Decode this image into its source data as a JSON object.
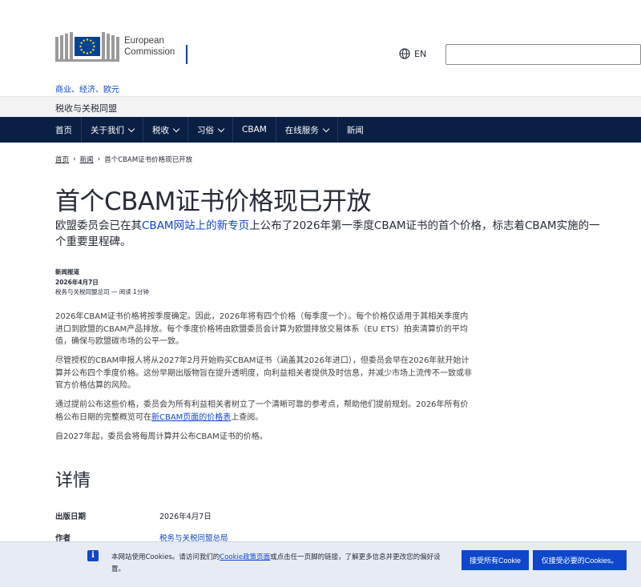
{
  "header": {
    "logo_line1": "European",
    "logo_line2": "Commission",
    "lang_code": "EN",
    "search_placeholder": "",
    "top_breadcrumb": "商业、经济、欧元"
  },
  "site": {
    "name": "税收与关税同盟"
  },
  "nav": {
    "items": [
      {
        "label": "首页",
        "dropdown": false
      },
      {
        "label": "关于我们",
        "dropdown": true
      },
      {
        "label": "税收",
        "dropdown": true
      },
      {
        "label": "习俗",
        "dropdown": true
      },
      {
        "label": "CBAM",
        "dropdown": false
      },
      {
        "label": "在线服务",
        "dropdown": true
      },
      {
        "label": "新闻",
        "dropdown": false
      }
    ]
  },
  "breadcrumbs": {
    "home": "首页",
    "news": "新闻",
    "current": "首个CBAM证书价格现已开放"
  },
  "article": {
    "title": "首个CBAM证书价格现已开放",
    "lead_before": "欧盟委员会已在其",
    "lead_link": "CBAM网站上的新专页",
    "lead_after": "上公布了2026年第一季度CBAM证书的首个价格，标志着CBAM实施的一个重要里程碑。",
    "type": "新闻报道",
    "date": "2026年4月7日",
    "author_line": "税务与关税同盟总司 — 阅读 1分钟",
    "p1": "2026年CBAM证书价格将按季度确定。因此，2026年将有四个价格（每季度一个）。每个价格仅适用于其相关季度内进口到欧盟的CBAM产品排放。每个季度价格将由欧盟委员会计算为欧盟排放交易体系（EU ETS）拍卖清算价的平均值，确保与欧盟碳市场的公平一致。",
    "p2": "尽管授权的CBAM申报人将从2027年2月开始购买CBAM证书（涵盖其2026年进口），但委员会早在2026年就开始计算并公布四个季度价格。这份早期出版物旨在提升透明度，向利益相关者提供及时信息，并减少市场上流传不一致或非官方价格估算的风险。",
    "p3_before": "通过提前公布这些价格，委员会为所有利益相关者树立了一个清晰可靠的参考点，帮助他们提前规划。2026年所有价格公布日期的完整概览可在",
    "p3_link": "新CBAM页面的价格表",
    "p3_after": "上查阅。",
    "p4": "自2027年起，委员会将每周计算并公布CBAM证书的价格。"
  },
  "details": {
    "heading": "详情",
    "pub_label": "出版日期",
    "pub_value": "2026年4月7日",
    "author_label": "作者",
    "author_value": "税务与关税同盟总局"
  },
  "cookie": {
    "text_before": "本网站使用Cookies。请访问我们的",
    "text_link": "Cookie政策页面",
    "text_after": "或点击任一页脚的链接，了解更多信息并更改您的偏好设置。",
    "accept_all": "接受所有Cookie",
    "accept_necessary": "仅接受必要的Cookies。"
  },
  "colors": {
    "nav_bg": "#0a1f44",
    "link": "#0e47cb",
    "eu_blue": "#004494",
    "eu_yellow": "#ffd617"
  }
}
